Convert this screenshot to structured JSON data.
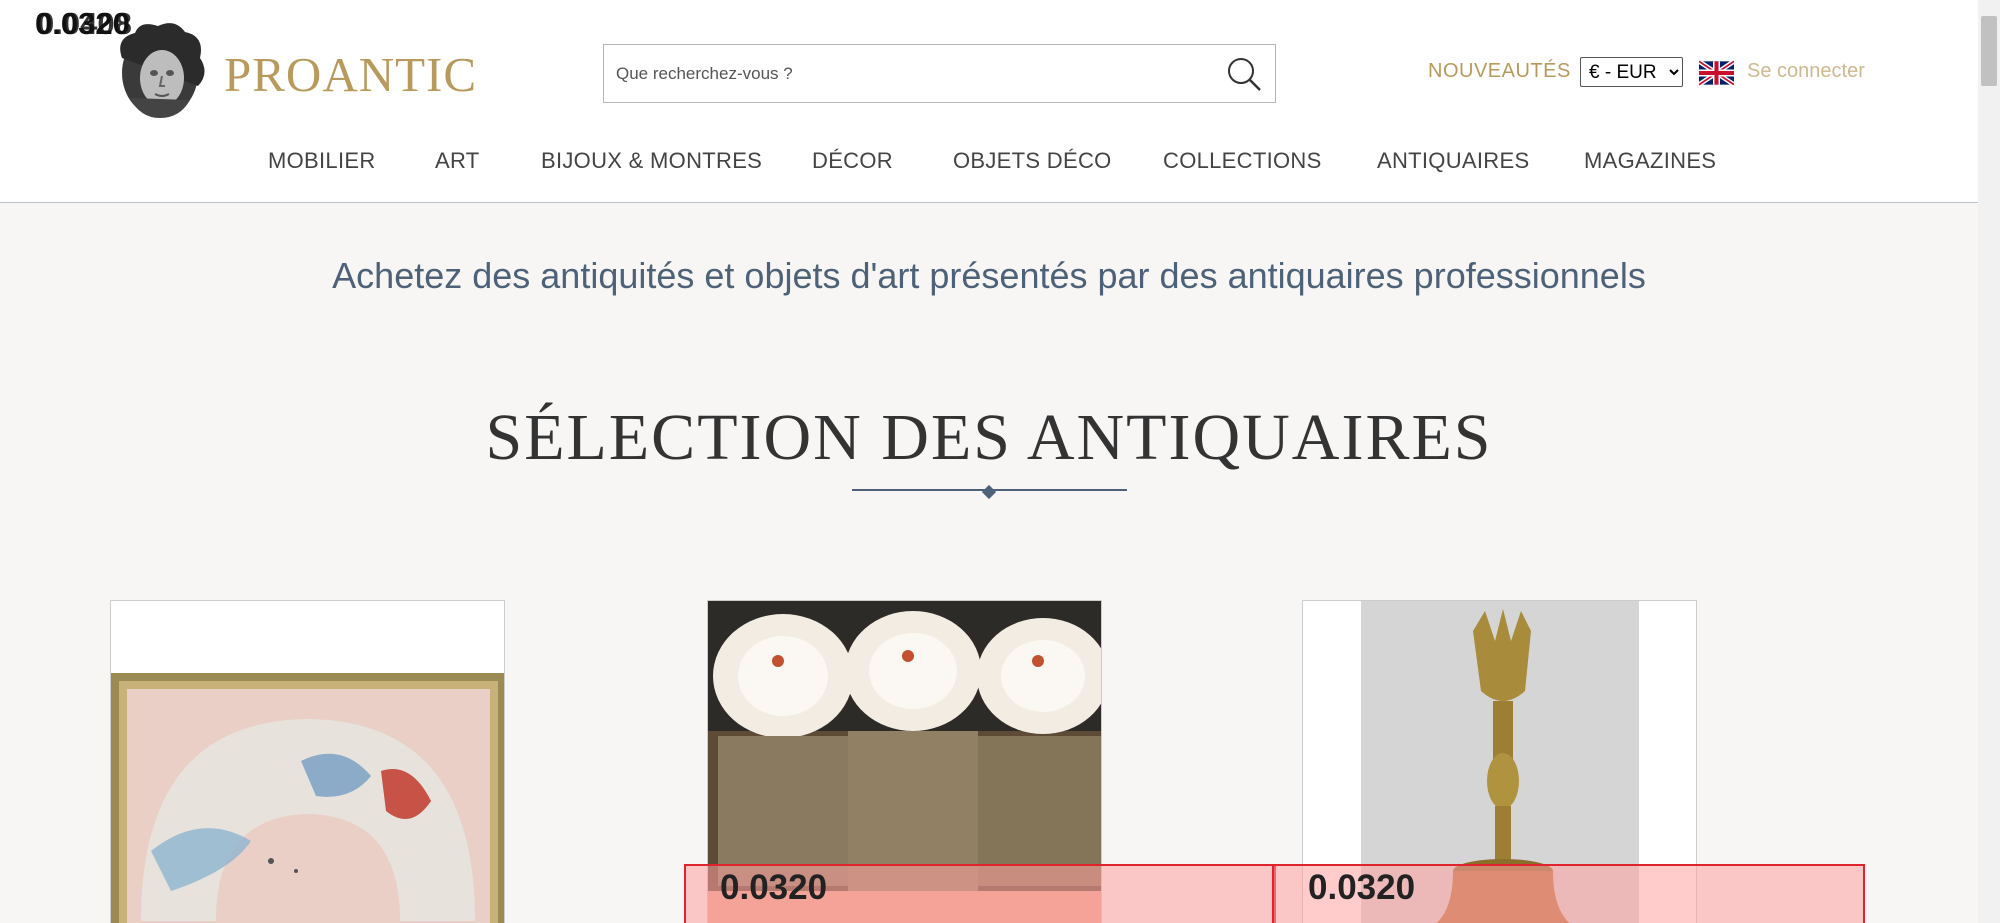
{
  "brand": {
    "name": "PROANTIC"
  },
  "search": {
    "placeholder": "Que recherchez-vous ?"
  },
  "header": {
    "new_label": "NOUVEAUTÉS",
    "currency": "€ - EUR",
    "currency_options": [
      "€ - EUR"
    ],
    "login_label": "Se connecter"
  },
  "nav": {
    "items": [
      {
        "label": "MOBILIER"
      },
      {
        "label": "ART"
      },
      {
        "label": "BIJOUX & MONTRES"
      },
      {
        "label": "DÉCOR"
      },
      {
        "label": "OBJETS DÉCO"
      },
      {
        "label": "COLLECTIONS"
      },
      {
        "label": "ANTIQUAIRES"
      },
      {
        "label": "MAGAZINES"
      }
    ]
  },
  "main": {
    "tagline": "Achetez des antiquités et objets d'art présentés par des antiquaires professionnels",
    "section_title": "SÉLECTION DES ANTIQUAIRES"
  },
  "overlays": {
    "corner_label_1": "0.0320",
    "corner_label_2": "0.0408",
    "box_1_label": "0.0320",
    "box_2_label": "0.0320"
  },
  "colors": {
    "accent_gold": "#b89a5c",
    "text_blue": "#4d6278",
    "overlay_border": "#e0242e"
  },
  "icons": {
    "search": "search-icon",
    "flag": "uk-flag-icon",
    "logo": "medusa-head-logo"
  }
}
